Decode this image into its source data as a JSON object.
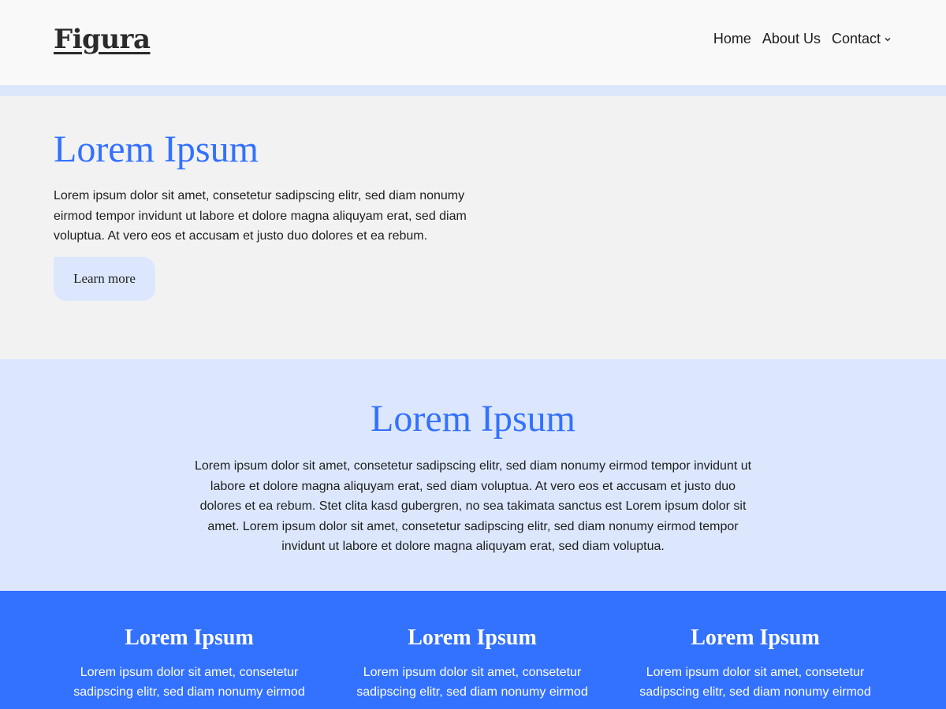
{
  "header": {
    "logo": "Figura",
    "nav": [
      {
        "label": "Home"
      },
      {
        "label": "About Us"
      },
      {
        "label": "Contact",
        "has_dropdown": true
      }
    ]
  },
  "hero": {
    "title": "Lorem Ipsum",
    "text": "Lorem ipsum dolor sit amet, consetetur sadipscing elitr, sed diam nonumy eirmod tempor invidunt ut labore et dolore magna aliquyam erat, sed diam voluptua. At vero eos et accusam et justo duo dolores et ea rebum.",
    "button_label": "Learn more"
  },
  "middle": {
    "title": "Lorem Ipsum",
    "text": "Lorem ipsum dolor sit amet, consetetur sadipscing elitr, sed diam nonumy eirmod tempor invidunt ut labore et dolore magna aliquyam erat, sed diam voluptua. At vero eos et accusam et justo duo dolores et ea rebum. Stet clita kasd gubergren, no sea takimata sanctus est Lorem ipsum dolor sit amet. Lorem ipsum dolor sit amet, consetetur sadipscing elitr, sed diam nonumy eirmod tempor invidunt ut labore et dolore magna aliquyam erat, sed diam voluptua."
  },
  "columns": [
    {
      "title": "Lorem Ipsum",
      "text": "Lorem ipsum dolor sit amet, consetetur sadipscing elitr, sed diam nonumy eirmod"
    },
    {
      "title": "Lorem Ipsum",
      "text": "Lorem ipsum dolor sit amet, consetetur sadipscing elitr, sed diam nonumy eirmod"
    },
    {
      "title": "Lorem Ipsum",
      "text": "Lorem ipsum dolor sit amet, consetetur sadipscing elitr, sed diam nonumy eirmod"
    }
  ],
  "colors": {
    "accent": "#3371ff",
    "accent_light": "#dce7fe",
    "hero_bg": "#f2f2f2",
    "header_bg": "#f9f9f9",
    "text": "#1e1e1e"
  },
  "icons": {
    "dropdown": "chevron-down-icon"
  }
}
